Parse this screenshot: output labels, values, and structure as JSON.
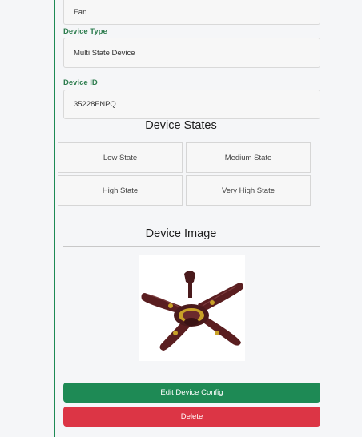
{
  "form": {
    "device_name_value": "Fan",
    "device_type_label": "Device Type",
    "device_type_value": "Multi State Device",
    "device_id_label": "Device ID",
    "device_id_value": "35228FNPQ"
  },
  "states_section": {
    "title": "Device States",
    "states": [
      "Low State",
      "Medium State",
      "High State",
      "Very High State"
    ]
  },
  "image_section": {
    "title": "Device Image",
    "image_icon": "ceiling-fan-image"
  },
  "actions": {
    "edit_label": "Edit Device Config",
    "delete_label": "Delete"
  },
  "colors": {
    "accent_green": "#1e8a55",
    "danger_red": "#dc3545",
    "label_green": "#2e7d4f"
  }
}
